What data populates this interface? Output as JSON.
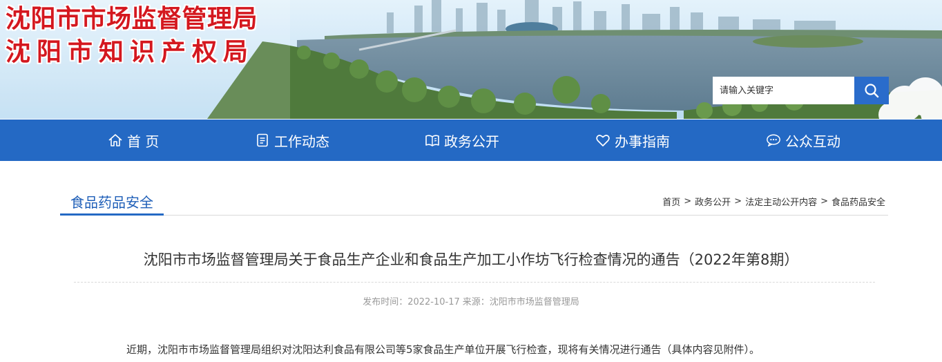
{
  "header": {
    "title_line1": "沈阳市市场监督管理局",
    "title_line2": "沈阳市知识产权局",
    "title_color": "#d4181f"
  },
  "search": {
    "placeholder": "请输入关键字",
    "button_icon": "search-icon"
  },
  "nav": {
    "background": "#2469c4",
    "items": [
      {
        "label": "首 页",
        "icon": "home-icon"
      },
      {
        "label": "工作动态",
        "icon": "document-icon"
      },
      {
        "label": "政务公开",
        "icon": "book-icon"
      },
      {
        "label": "办事指南",
        "icon": "heart-icon"
      },
      {
        "label": "公众互动",
        "icon": "chat-icon"
      }
    ]
  },
  "section": {
    "title": "食品药品安全"
  },
  "breadcrumb": {
    "items": [
      "首页",
      "政务公开",
      "法定主动公开内容",
      "食品药品安全"
    ],
    "separator": ">"
  },
  "article": {
    "title": "沈阳市市场监督管理局关于食品生产企业和食品生产加工小作坊飞行检查情况的通告（2022年第8期）",
    "publish_label": "发布时间：",
    "publish_date": "2022-10-17",
    "source_label": "来源：",
    "source": "沈阳市市场监督管理局",
    "body": "近期，沈阳市市场监督管理局组织对沈阳达利食品有限公司等5家食品生产单位开展飞行检查，现将有关情况进行通告（具体内容见附件）。"
  }
}
